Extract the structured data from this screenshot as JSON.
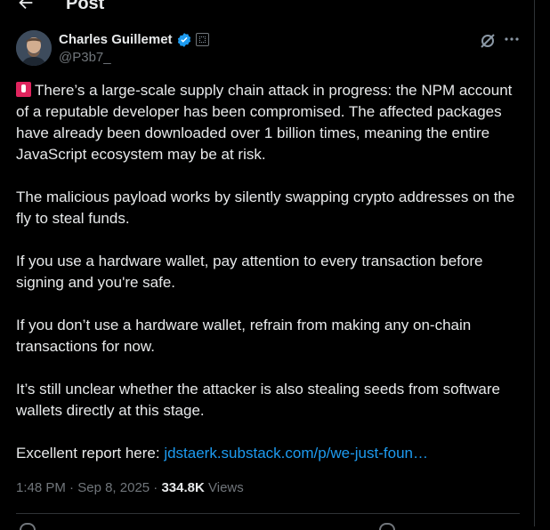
{
  "header": {
    "title": "Post"
  },
  "author": {
    "name": "Charles Guillemet",
    "handle": "@P3b7_"
  },
  "tweet": {
    "p1": "There’s a large-scale supply chain attack in progress: the NPM account of a reputable developer has been compromised. The affected packages have already been downloaded over 1 billion times, meaning the entire JavaScript ecosystem may be at risk.",
    "p2": "The malicious payload works by silently swapping crypto addresses on the fly to steal funds.",
    "p3": "If you use a hardware wallet, pay attention to every transaction before signing and you're safe.",
    "p4": "If you don’t use a hardware wallet, refrain from making any on-chain transactions for now.",
    "p5": "It’s still unclear whether the attacker is also stealing seeds from software wallets directly at this stage.",
    "p6_prefix": "Excellent report here: ",
    "p6_link": "jdstaerk.substack.com/p/we-just-foun…"
  },
  "meta": {
    "time": "1:48 PM",
    "sep": " · ",
    "date": "Sep 8, 2025",
    "views_count": "334.8K",
    "views_label": "Views"
  },
  "icons": {
    "back": "arrow-left-icon",
    "verified": "verified-badge-icon",
    "affiliate": "affiliate-badge-icon",
    "grok": "grok-icon",
    "more": "more-horizontal-icon",
    "siren": "siren-emoji-icon"
  },
  "colors": {
    "accent": "#1d9bf0",
    "muted": "#71767b",
    "text": "#e7e9ea",
    "background": "#000000"
  }
}
